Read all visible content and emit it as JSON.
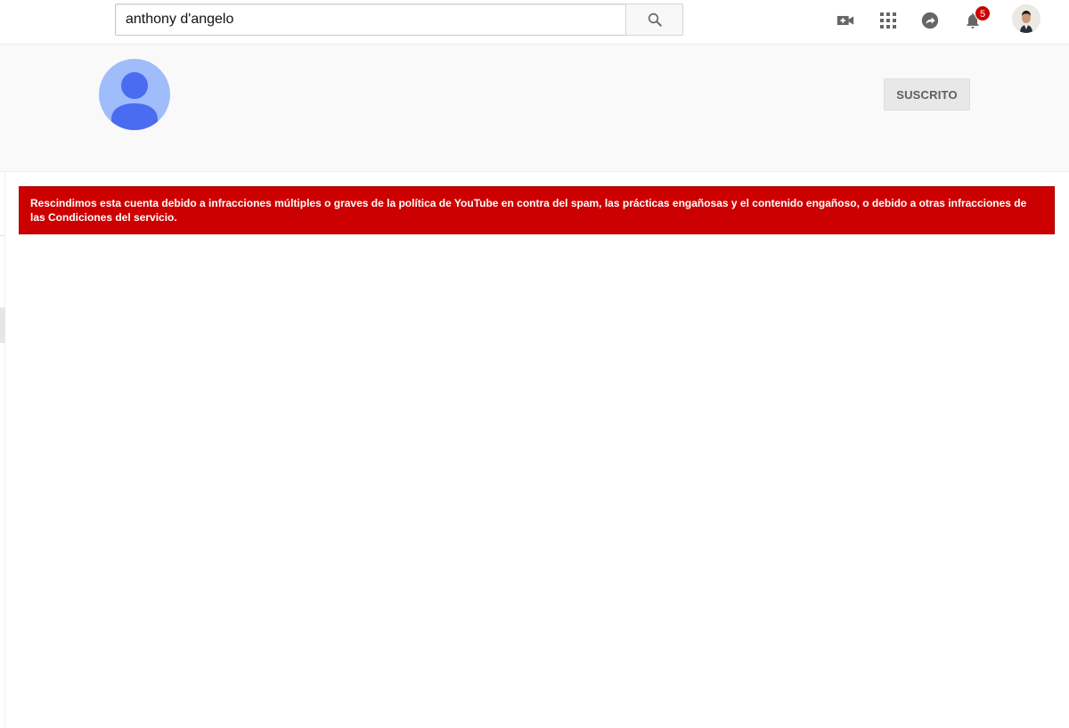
{
  "masthead": {
    "search": {
      "value": "anthony d'angelo",
      "button_icon": "search-icon"
    },
    "icons": {
      "upload": "video-camera-plus-icon",
      "apps": "apps-grid-icon",
      "messages": "share-arrow-icon",
      "notifications": "bell-icon"
    },
    "notification_count": "5",
    "account": "account-avatar"
  },
  "channel": {
    "avatar": "default-user-icon",
    "subscribe_label": "SUSCRITO"
  },
  "alert": {
    "message": "Rescindimos esta cuenta debido a infracciones múltiples o graves de la política de YouTube en contra del spam, las prácticas engañosas y el contenido engañoso, o debido a otras infracciones de las Condiciones del servicio."
  },
  "colors": {
    "alert_background": "#cc0000",
    "channel_avatar_bg": "#9fbcfb",
    "channel_avatar_figure": "#4a6cf0",
    "header_background": "#f9f9f9"
  }
}
